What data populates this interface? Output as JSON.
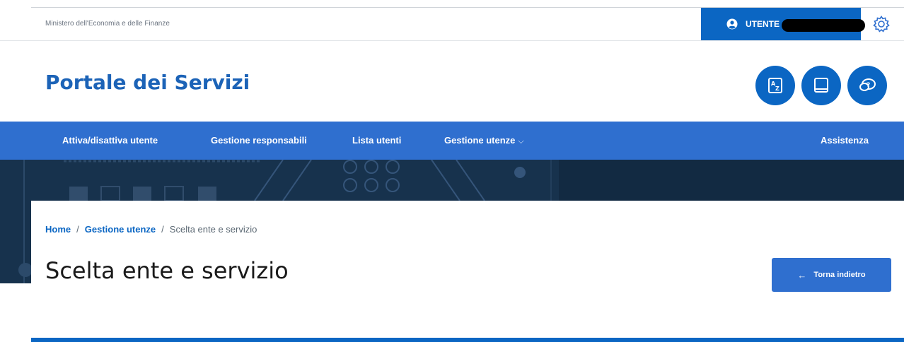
{
  "topbar": {
    "ministry": "Ministero dell'Economia e delle Finanze",
    "user_label": "UTENTE"
  },
  "header": {
    "title": "Portale dei Servizi"
  },
  "nav": {
    "items": [
      {
        "label": "Attiva/disattiva utente"
      },
      {
        "label": "Gestione responsabili"
      },
      {
        "label": "Lista utenti"
      },
      {
        "label": "Gestione utenze",
        "chevron": "⌵"
      },
      {
        "label": "Assistenza"
      }
    ]
  },
  "breadcrumb": {
    "home": "Home",
    "section": "Gestione utenze",
    "current": "Scelta ente e servizio",
    "separator": "/"
  },
  "page": {
    "title": "Scelta ente e servizio",
    "back_label": "Torna indietro",
    "back_arrow": "←"
  },
  "colors": {
    "primary": "#0b66c3",
    "nav": "#2f6fcf",
    "hero": "#17324d"
  },
  "icons": [
    "user-circle-icon",
    "gear-icon",
    "az-glossary-icon",
    "book-icon",
    "help-chat-icon",
    "arrow-left-icon",
    "chevron-down-icon"
  ]
}
